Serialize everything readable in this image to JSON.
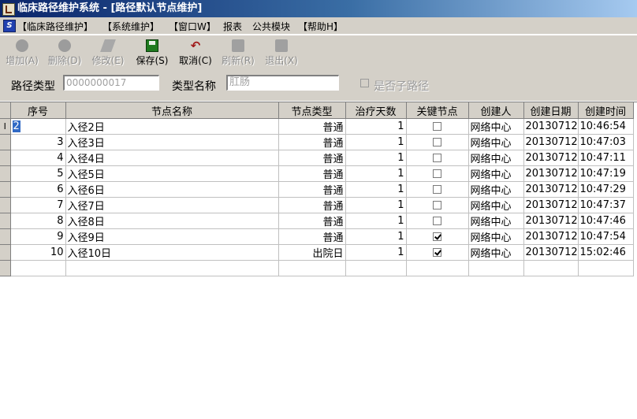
{
  "window": {
    "title": "临床路径维护系统 - [路径默认节点维护]"
  },
  "menu": {
    "items": [
      "【临床路径维护】",
      "【系统维护】",
      "【窗口W】",
      "报表",
      "公共模块",
      "【帮助H】"
    ]
  },
  "toolbar": {
    "buttons": [
      {
        "label": "增加(A)",
        "enabled": false
      },
      {
        "label": "删除(D)",
        "enabled": false
      },
      {
        "label": "修改(E)",
        "enabled": false
      },
      {
        "label": "保存(S)",
        "enabled": true
      },
      {
        "label": "取消(C)",
        "enabled": true
      },
      {
        "label": "刷新(R)",
        "enabled": false
      },
      {
        "label": "退出(X)",
        "enabled": false
      }
    ]
  },
  "filter": {
    "path_type_label": "路径类型",
    "path_type_value": "0000000017",
    "type_name_label": "类型名称",
    "type_name_value": "肛肠",
    "is_sub_path_label": "是否子路径",
    "is_sub_path_checked": false
  },
  "grid": {
    "columns": [
      "序号",
      "节点名称",
      "节点类型",
      "治疗天数",
      "关键节点",
      "创建人",
      "创建日期",
      "创建时间"
    ],
    "current_row_marker": "I",
    "rows": [
      {
        "seq": "2",
        "name": "入径2日",
        "type": "普通",
        "days": "1",
        "key": false,
        "creator": "网络中心",
        "date": "20130712",
        "time": "10:46:54"
      },
      {
        "seq": "3",
        "name": "入径3日",
        "type": "普通",
        "days": "1",
        "key": false,
        "creator": "网络中心",
        "date": "20130712",
        "time": "10:47:03"
      },
      {
        "seq": "4",
        "name": "入径4日",
        "type": "普通",
        "days": "1",
        "key": false,
        "creator": "网络中心",
        "date": "20130712",
        "time": "10:47:11"
      },
      {
        "seq": "5",
        "name": "入径5日",
        "type": "普通",
        "days": "1",
        "key": false,
        "creator": "网络中心",
        "date": "20130712",
        "time": "10:47:19"
      },
      {
        "seq": "6",
        "name": "入径6日",
        "type": "普通",
        "days": "1",
        "key": false,
        "creator": "网络中心",
        "date": "20130712",
        "time": "10:47:29"
      },
      {
        "seq": "7",
        "name": "入径7日",
        "type": "普通",
        "days": "1",
        "key": false,
        "creator": "网络中心",
        "date": "20130712",
        "time": "10:47:37"
      },
      {
        "seq": "8",
        "name": "入径8日",
        "type": "普通",
        "days": "1",
        "key": false,
        "creator": "网络中心",
        "date": "20130712",
        "time": "10:47:46"
      },
      {
        "seq": "9",
        "name": "入径9日",
        "type": "普通",
        "days": "1",
        "key": true,
        "creator": "网络中心",
        "date": "20130712",
        "time": "10:47:54"
      },
      {
        "seq": "10",
        "name": "入径10日",
        "type": "出院日",
        "days": "1",
        "key": true,
        "creator": "网络中心",
        "date": "20130712",
        "time": "15:02:46"
      }
    ]
  },
  "colors": {
    "title_start": "#0a246a",
    "title_end": "#a6caf0",
    "selection": "#316ac5",
    "face": "#d4d0c8"
  }
}
